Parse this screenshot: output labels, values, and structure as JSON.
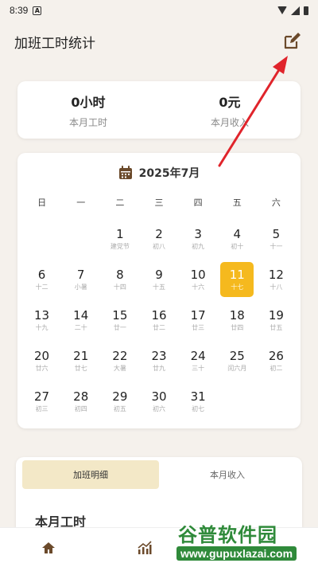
{
  "status_bar": {
    "time": "8:39",
    "notification_badge": "A"
  },
  "header": {
    "title": "加班工时统计",
    "edit_icon": "edit-square-icon"
  },
  "summary": {
    "hours_value": "0小时",
    "hours_label": "本月工时",
    "income_value": "0元",
    "income_label": "本月收入"
  },
  "calendar": {
    "month_label": "2025年7月",
    "weekdays": [
      "日",
      "一",
      "二",
      "三",
      "四",
      "五",
      "六"
    ],
    "selected_day": "11",
    "selected_color": "#f5b91e",
    "days": [
      {
        "num": "1",
        "lunar": "建党节"
      },
      {
        "num": "2",
        "lunar": "初八"
      },
      {
        "num": "3",
        "lunar": "初九"
      },
      {
        "num": "4",
        "lunar": "初十"
      },
      {
        "num": "5",
        "lunar": "十一"
      },
      {
        "num": "6",
        "lunar": "十二"
      },
      {
        "num": "7",
        "lunar": "小暑"
      },
      {
        "num": "8",
        "lunar": "十四"
      },
      {
        "num": "9",
        "lunar": "十五"
      },
      {
        "num": "10",
        "lunar": "十六"
      },
      {
        "num": "11",
        "lunar": "十七"
      },
      {
        "num": "12",
        "lunar": "十八"
      },
      {
        "num": "13",
        "lunar": "十九"
      },
      {
        "num": "14",
        "lunar": "二十"
      },
      {
        "num": "15",
        "lunar": "廿一"
      },
      {
        "num": "16",
        "lunar": "廿二"
      },
      {
        "num": "17",
        "lunar": "廿三"
      },
      {
        "num": "18",
        "lunar": "廿四"
      },
      {
        "num": "19",
        "lunar": "廿五"
      },
      {
        "num": "20",
        "lunar": "廿六"
      },
      {
        "num": "21",
        "lunar": "廿七"
      },
      {
        "num": "22",
        "lunar": "大暑"
      },
      {
        "num": "23",
        "lunar": "廿九"
      },
      {
        "num": "24",
        "lunar": "三十"
      },
      {
        "num": "25",
        "lunar": "闰六月"
      },
      {
        "num": "26",
        "lunar": "初二"
      },
      {
        "num": "27",
        "lunar": "初三"
      },
      {
        "num": "28",
        "lunar": "初四"
      },
      {
        "num": "29",
        "lunar": "初五"
      },
      {
        "num": "30",
        "lunar": "初六"
      },
      {
        "num": "31",
        "lunar": "初七"
      }
    ]
  },
  "detail_tabs": [
    "加班明细",
    "本月收入"
  ],
  "section_title": "本月工时",
  "nav": {
    "home_icon": "home-icon",
    "stats_icon": "chart-icon"
  },
  "watermark": {
    "title": "谷普软件园",
    "url": "www.gupuxlazai.com"
  },
  "colors": {
    "accent": "#f5b91e",
    "tab_active_bg": "#f3e8c7",
    "arrow": "#e0242b",
    "brand_icon": "#6b4a2b"
  }
}
